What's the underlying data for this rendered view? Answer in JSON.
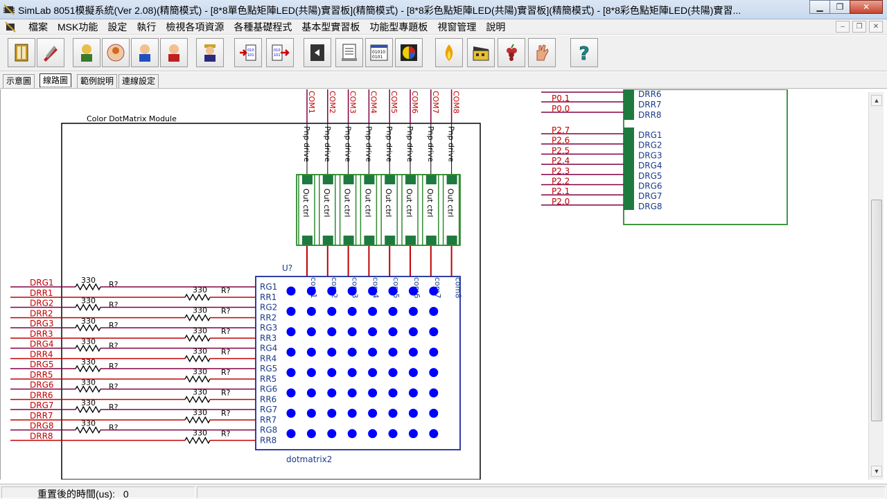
{
  "window": {
    "title": "SimLab 8051模擬系統(Ver  2.08)(精簡模式) - [8*8單色點矩陣LED(共陽)實習板](精簡模式) - [8*8彩色點矩陣LED(共陽)實習板](精簡模式) - [8*8彩色點矩陣LED(共陽)實習..."
  },
  "menu": {
    "items": [
      "檔案",
      "MSK功能",
      "設定",
      "執行",
      "檢視各項資源",
      "各種基礎程式",
      "基本型實習板",
      "功能型專題板",
      "視窗管理",
      "說明"
    ]
  },
  "toolbar": {
    "icons": [
      "book-icon",
      "pen-tool-icon",
      "person-yellow-icon",
      "person-circle-icon",
      "person-blue-icon",
      "person-red-icon",
      "person-cap-icon",
      "import-icon",
      "export-icon",
      "chip-icon",
      "document-icon",
      "binary-icon",
      "color-chart-icon",
      "flame-icon",
      "clapperboard-icon",
      "grapes-icon",
      "hand-icon",
      "help-icon"
    ]
  },
  "tabs": [
    "示意圖",
    "線路圖",
    "範例說明",
    "連線設定"
  ],
  "active_tab": "線路圖",
  "schematic": {
    "module_title": "Color DotMatrix Module",
    "component_ref": "U?",
    "component_name": "dotmatrix2",
    "com_labels": [
      "COM1",
      "COM2",
      "COM3",
      "COM4",
      "COM5",
      "COM6",
      "COM7",
      "COM8"
    ],
    "driver_label": "Pnp drive",
    "buffer_label": "Out  ctrl",
    "col_pin_labels": [
      "com1",
      "com2",
      "com3",
      "com4",
      "com5",
      "com6",
      "com7",
      "com8"
    ],
    "row_pins": [
      "RG1",
      "RR1",
      "RG2",
      "RR2",
      "RG3",
      "RR3",
      "RG4",
      "RR4",
      "RG5",
      "RR5",
      "RG6",
      "RR6",
      "RG7",
      "RR7",
      "RG8",
      "RR8"
    ],
    "net_labels": [
      "DRG1",
      "DRR1",
      "DRG2",
      "DRR2",
      "DRG3",
      "DRR3",
      "DRG4",
      "DRR4",
      "DRG5",
      "DRR5",
      "DRG6",
      "DRR6",
      "DRG7",
      "DRR7",
      "DRG8",
      "DRR8"
    ],
    "resistor_value": "330",
    "resistor_ref": "R?",
    "port_p0": [
      "P0.1",
      "P0.0"
    ],
    "port_p2": [
      "P2.7",
      "P2.6",
      "P2.5",
      "P2.4",
      "P2.3",
      "P2.2",
      "P2.1",
      "P2.0"
    ],
    "mcu_top_pins": [
      "DRR6",
      "DRR7",
      "DRR8"
    ],
    "mcu_green_pins": [
      "DRG1",
      "DRG2",
      "DRG3",
      "DRG4",
      "DRG5",
      "DRG6",
      "DRG7",
      "DRG8"
    ]
  },
  "colors": {
    "wire_red": "#c00000",
    "wire_maroon": "#800040",
    "net_label": "#c00000",
    "pin_blue": "#1a3a8a",
    "led_blue": "#0000ff",
    "box_green": "#2e8b2e",
    "pad_green": "#1f7a3f"
  },
  "status": {
    "label": "重置後的時間(us):",
    "value": "0"
  }
}
